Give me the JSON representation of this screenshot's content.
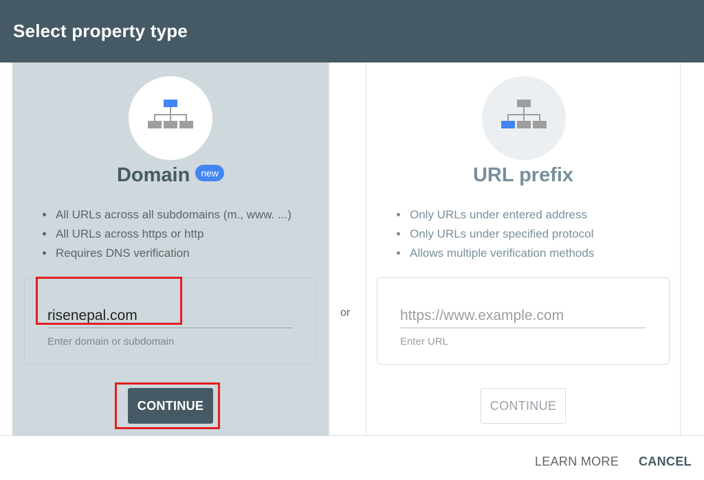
{
  "header": {
    "title": "Select property type"
  },
  "domain_card": {
    "title": "Domain",
    "badge": "new",
    "bullets": [
      "All URLs across all subdomains (m., www. ...)",
      "All URLs across https or http",
      "Requires DNS verification"
    ],
    "input_value": "risenepal.com",
    "input_hint": "Enter domain or subdomain",
    "continue_label": "CONTINUE"
  },
  "separator": "or",
  "url_card": {
    "title": "URL prefix",
    "bullets": [
      "Only URLs under entered address",
      "Only URLs under specified protocol",
      "Allows multiple verification methods"
    ],
    "input_placeholder": "https://www.example.com",
    "input_hint": "Enter URL",
    "continue_label": "CONTINUE"
  },
  "footer": {
    "learn_more": "LEARN MORE",
    "cancel": "CANCEL"
  },
  "colors": {
    "header_bg": "#455a64",
    "selected_card_bg": "#cfd8dc",
    "accent_blue": "#4285f4",
    "highlight_red": "#e02020"
  },
  "icons": {
    "domain": "sitemap-root-icon",
    "url_prefix": "sitemap-leaf-icon"
  }
}
